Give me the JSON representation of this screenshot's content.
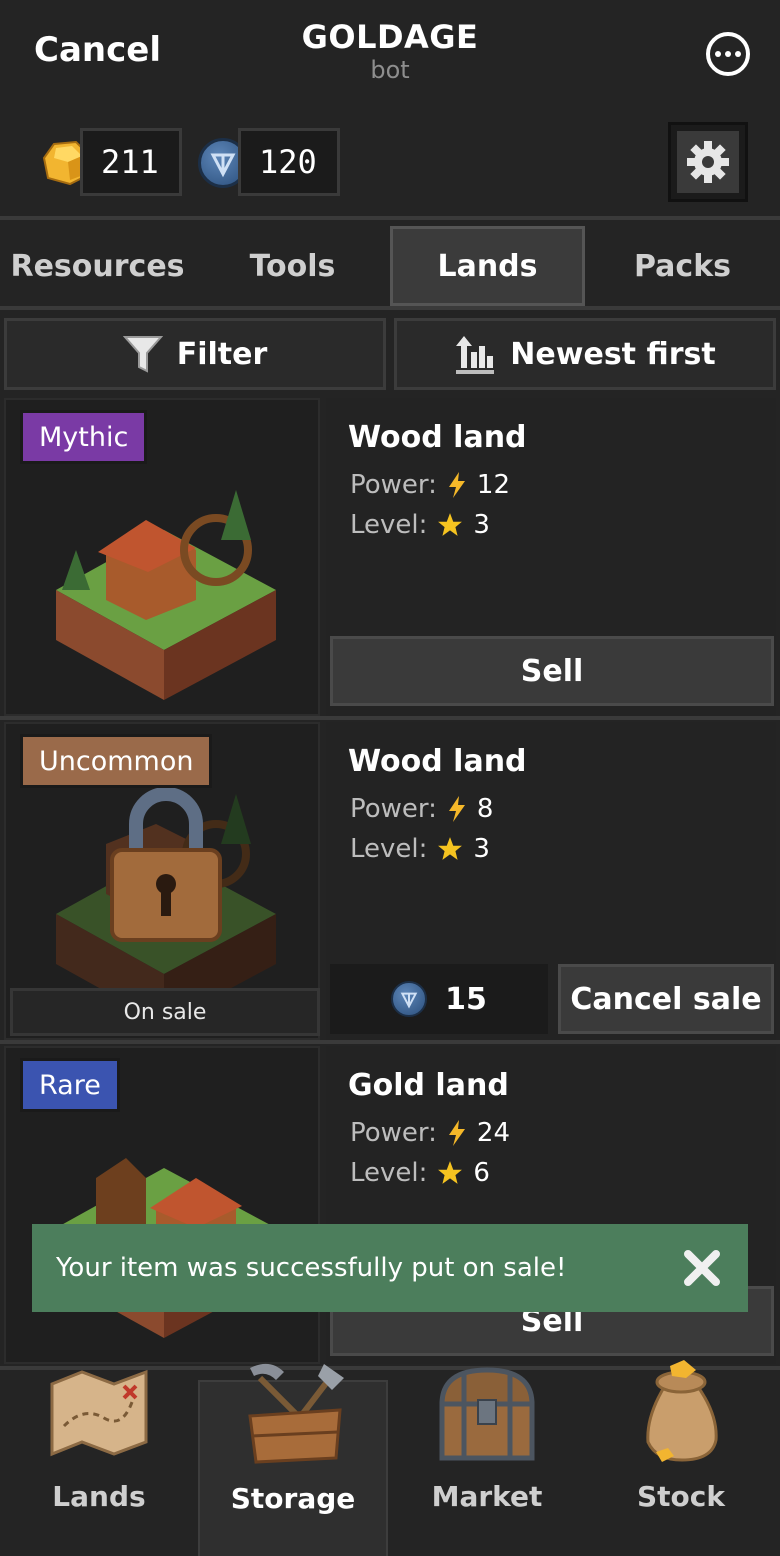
{
  "header": {
    "cancel_label": "Cancel",
    "title": "GOLDAGE",
    "subtitle": "bot",
    "more_icon": "more-icon"
  },
  "balances": {
    "gold": "211",
    "ton": "120"
  },
  "tabs": [
    {
      "label": "Resources",
      "active": false
    },
    {
      "label": "Tools",
      "active": false
    },
    {
      "label": "Lands",
      "active": true
    },
    {
      "label": "Packs",
      "active": false
    }
  ],
  "filters": {
    "filter_label": "Filter",
    "sort_label": "Newest first"
  },
  "items": [
    {
      "rarity": "Mythic",
      "name": "Wood land",
      "power_label": "Power:",
      "power": "12",
      "level_label": "Level:",
      "level": "3",
      "action": "Sell"
    },
    {
      "rarity": "Uncommon",
      "name": "Wood land",
      "power_label": "Power:",
      "power": "8",
      "level_label": "Level:",
      "level": "3",
      "status": "On sale",
      "price": "15",
      "action": "Cancel sale"
    },
    {
      "rarity": "Rare",
      "name": "Gold land",
      "power_label": "Power:",
      "power": "24",
      "level_label": "Level:",
      "level": "6",
      "action": "Sell"
    }
  ],
  "toast": {
    "message": "Your item was successfully put on sale!"
  },
  "nav": [
    {
      "label": "Lands",
      "icon": "map-icon",
      "active": false
    },
    {
      "label": "Storage",
      "icon": "toolbox-icon",
      "active": true
    },
    {
      "label": "Market",
      "icon": "chest-icon",
      "active": false
    },
    {
      "label": "Stock",
      "icon": "gold-bag-icon",
      "active": false
    }
  ],
  "colors": {
    "mythic": "#7a3aa5",
    "uncommon": "#9a6a4a",
    "rare": "#3b54b0",
    "toast": "#4c7e5c"
  }
}
